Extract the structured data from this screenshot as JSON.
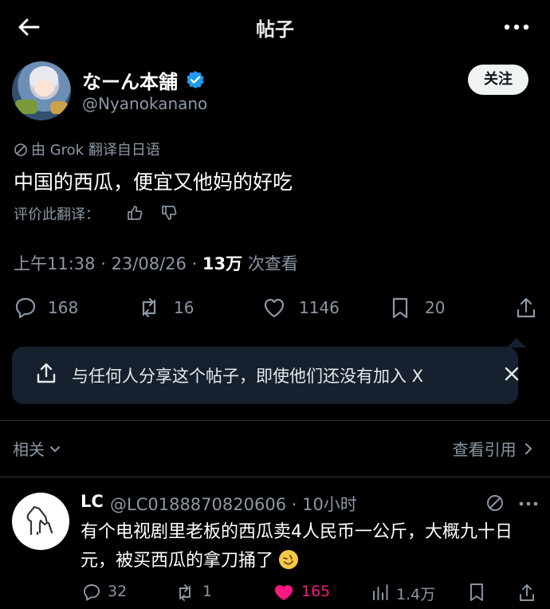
{
  "header": {
    "title": "帖子"
  },
  "post": {
    "author_name": "なーん本舗",
    "author_handle": "@Nyanokanano",
    "follow_label": "关注",
    "translation_note": "由 Grok 翻译自日语",
    "text": "中国的西瓜，便宜又他妈的好吃",
    "rate_label": "评价此翻译：",
    "time": "上午11:38",
    "date": "23/08/26",
    "views_count": "13万",
    "views_label": "次查看",
    "replies": "168",
    "reposts": "16",
    "likes": "1146",
    "bookmarks": "20"
  },
  "share_banner": {
    "text": "与任何人分享这个帖子，即使他们还没有加入 X"
  },
  "related": {
    "label": "相关",
    "view_quotes": "查看引用"
  },
  "reply": {
    "name": "LC",
    "handle_time": "@LC0188870820606 · 10小时",
    "text": "有个电视剧里老板的西瓜卖4人民币一公斤，大概九十日元，被买西瓜的拿刀捅了",
    "replies": "32",
    "reposts": "1",
    "likes": "165",
    "views": "1.4万"
  },
  "colors": {
    "like": "#f91880",
    "verified": "#1d9bf0",
    "banner": "#16202e"
  },
  "icons": [
    "back-arrow-icon",
    "more-icon",
    "verified-badge-icon",
    "grok-icon",
    "thumb-up-icon",
    "thumb-down-icon",
    "reply-icon",
    "repost-icon",
    "like-icon",
    "bookmark-icon",
    "share-icon",
    "close-icon",
    "chevron-down-icon",
    "chevron-right-icon",
    "views-icon",
    "horse-icon",
    "rofl-emoji-icon"
  ]
}
